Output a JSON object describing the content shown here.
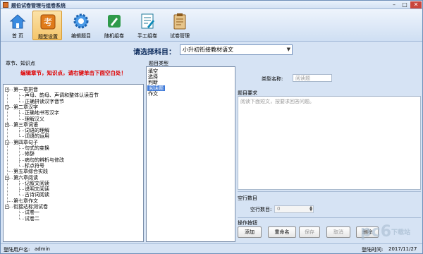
{
  "window": {
    "title": "题伯试卷管理与组卷系统",
    "controls": [
      "–",
      "□",
      "✕"
    ]
  },
  "toolbar": {
    "items": [
      {
        "label": "首 页",
        "icon": "home-icon"
      },
      {
        "label": "题型设置",
        "icon": "exam-icon"
      },
      {
        "label": "编辑题目",
        "icon": "gear-icon"
      },
      {
        "label": "随机组卷",
        "icon": "pencil-icon"
      },
      {
        "label": "手工组卷",
        "icon": "edit-doc-icon"
      },
      {
        "label": "试卷管理",
        "icon": "clipboard-icon"
      }
    ]
  },
  "subject": {
    "label": "请选择科目：",
    "value": "小升初衔接教材语文"
  },
  "chapters": {
    "group_label": "章节、知识点",
    "hint": "编辑章节，知识点，请右键单击下面空白处！",
    "tree": [
      {
        "text": "第一章拼音",
        "level": 0
      },
      {
        "text": "声母、韵母、声调和整体认读音节",
        "level": 1
      },
      {
        "text": "正确拼读汉字音节",
        "level": 1
      },
      {
        "text": "第二章汉字",
        "level": 0
      },
      {
        "text": "正确地书写汉字",
        "level": 1
      },
      {
        "text": "理解汉义",
        "level": 1
      },
      {
        "text": "第三章词语",
        "level": 0
      },
      {
        "text": "词语的理解",
        "level": 1
      },
      {
        "text": "词语的运用",
        "level": 1
      },
      {
        "text": "第四章句子",
        "level": 0
      },
      {
        "text": "句式的变换",
        "level": 1
      },
      {
        "text": "修辞",
        "level": 1
      },
      {
        "text": "病句的辨析与修改",
        "level": 1
      },
      {
        "text": "标点符号",
        "level": 1
      },
      {
        "text": "第五章综合实践",
        "level": 0
      },
      {
        "text": "第六章阅读",
        "level": 0
      },
      {
        "text": "记叙文阅读",
        "level": 1
      },
      {
        "text": "说明文阅读",
        "level": 1
      },
      {
        "text": "古诗词阅读",
        "level": 1
      },
      {
        "text": "第七章作文",
        "level": 0
      },
      {
        "text": "衔接达标测试卷",
        "level": 0
      },
      {
        "text": "试卷一",
        "level": 1
      },
      {
        "text": "试卷二",
        "level": 1
      }
    ]
  },
  "types": {
    "group_label": "题目类型",
    "items": [
      "填空",
      "选择",
      "判断",
      "阅读题",
      "作文"
    ],
    "selected_index": 3
  },
  "detail": {
    "type_name_label": "类型名称:",
    "type_name_value": "阅读题",
    "req_label": "题目要求",
    "req_value": "阅读下面短文，按要求回答问题。",
    "blank_group_label": "空行数目",
    "blank_field_label": "空行数目:",
    "blank_field_value": "0",
    "ops_label": "操作按钮",
    "buttons": [
      "添加",
      "重命名",
      "保存",
      "取消",
      "删除"
    ]
  },
  "status": {
    "user_label": "登陆用户名:",
    "user_value": "admin",
    "time_label": "登陆时间:",
    "time_value": "2017/11/27"
  },
  "watermark": {
    "big": "pc6",
    "small": "下载站"
  },
  "colors": {
    "accent": "#3c78d8",
    "hint": "#e00000",
    "window_bg": "#d6e3f4"
  }
}
